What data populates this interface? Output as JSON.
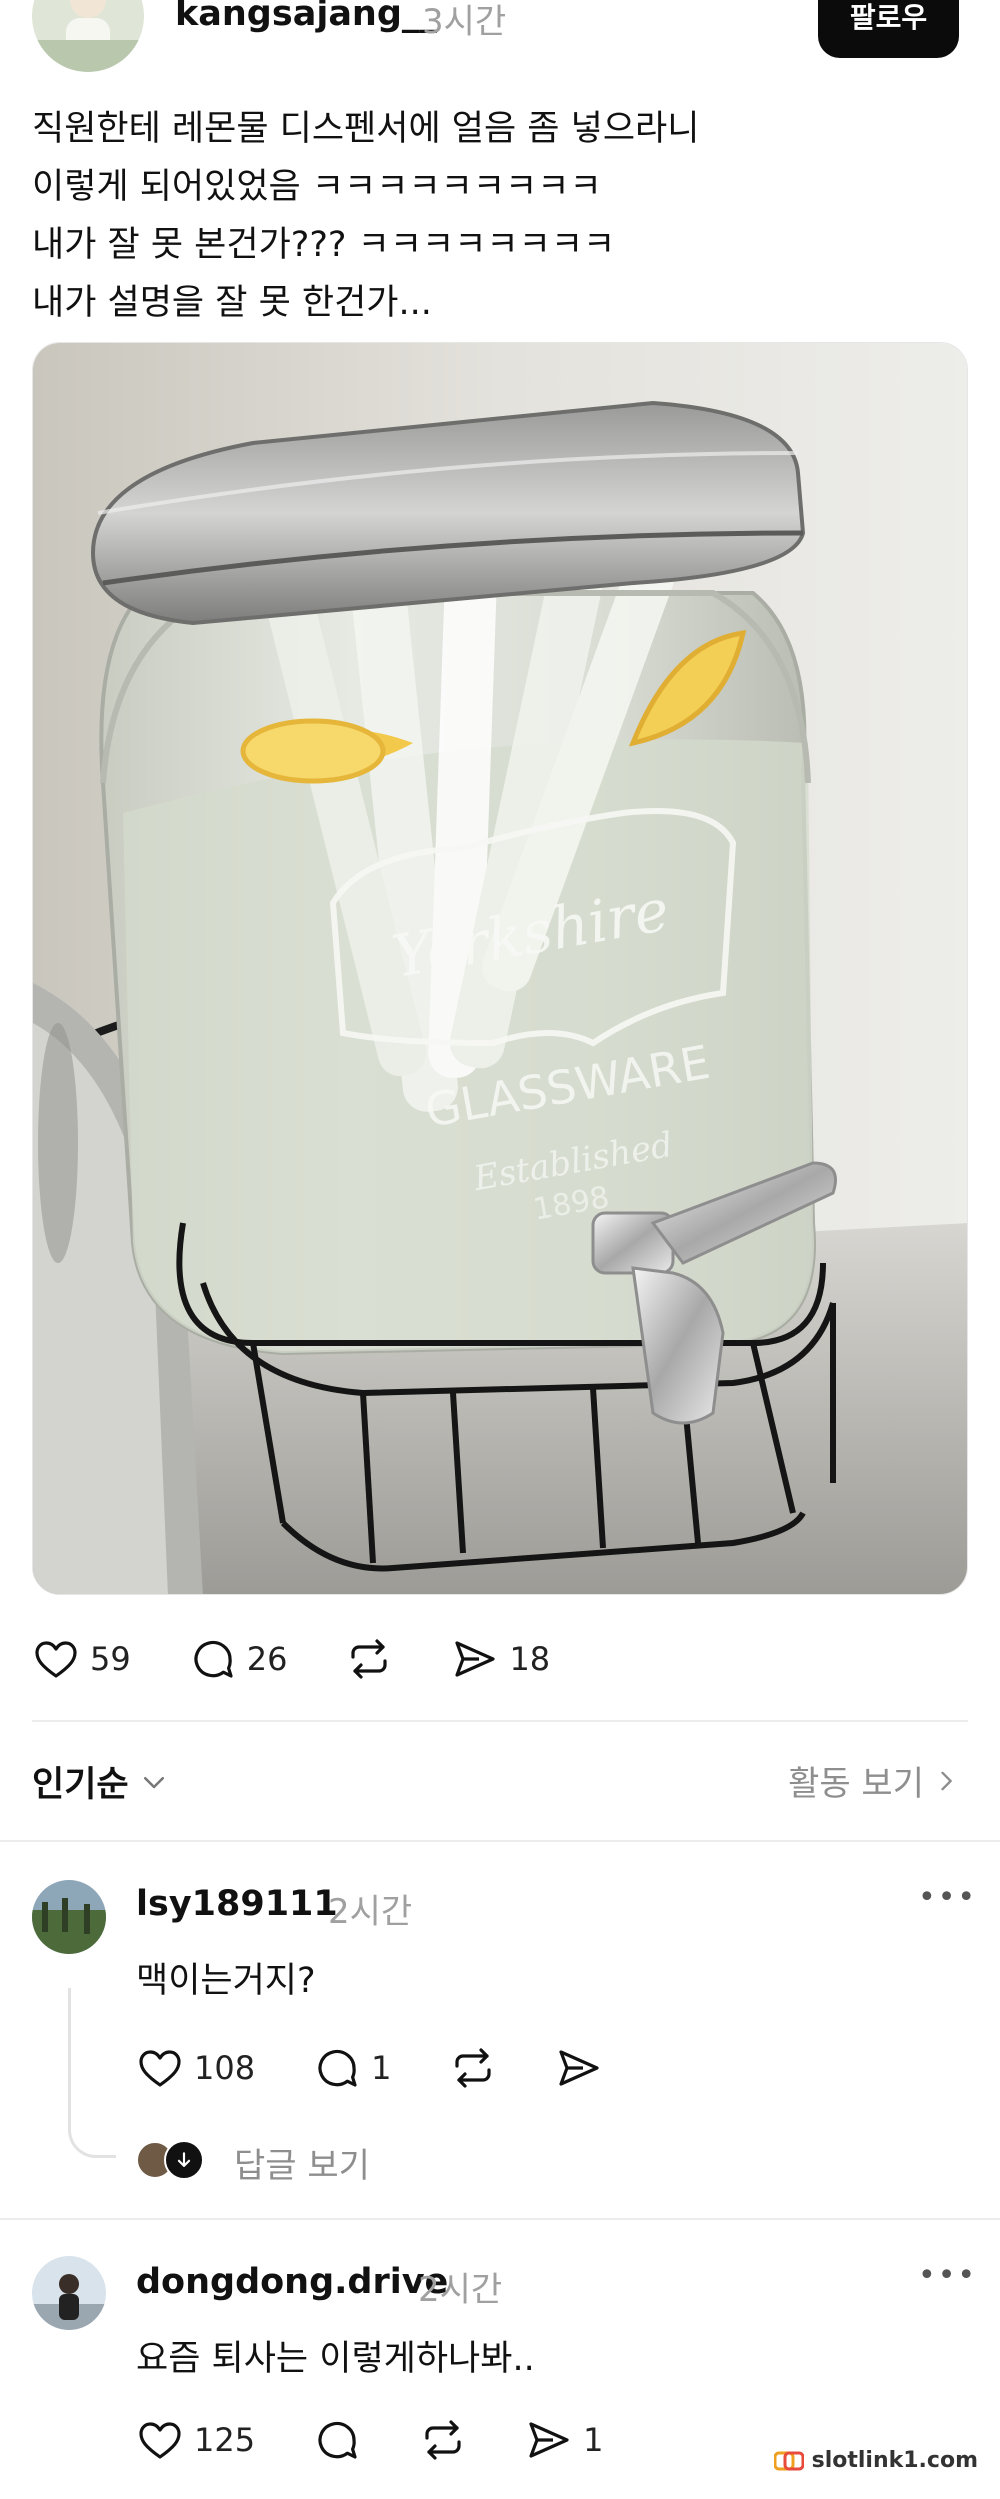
{
  "post": {
    "username": "kangsajang__",
    "time": "3시간",
    "follow_label": "팔로우",
    "text_lines": [
      "직원한테 레몬물 디스펜서에 얼음 좀 넣으라니",
      "이렇게 되어있었음 ㅋㅋㅋㅋㅋㅋㅋㅋㅋ",
      "내가 잘 못 본건가??? ㅋㅋㅋㅋㅋㅋㅋㅋ",
      "내가 설명을 잘 못 한건가..."
    ],
    "photo": {
      "jar_text_brand": "Yorkshire",
      "jar_text_line2": "GLASSWARE",
      "jar_text_line3": "Established",
      "jar_text_line4": "1898"
    },
    "likes": "59",
    "comments": "26",
    "shares": "18"
  },
  "sort": {
    "label": "인기순",
    "activity_label": "활동 보기"
  },
  "comments": [
    {
      "username": "lsy189111",
      "time": "2시간",
      "text": "맥이는거지?",
      "likes": "108",
      "replies_count": "1",
      "view_replies": "답글 보기"
    },
    {
      "username": "dongdong.drive",
      "time": "2시간",
      "text": "요즘 퇴사는 이렇게하나봐..",
      "likes": "125",
      "shares": "1"
    }
  ],
  "watermark": "slotlink1.com",
  "colors": {
    "follow_bg": "#0b0b0b",
    "muted": "#a0a0a0",
    "divider": "#ececec"
  }
}
